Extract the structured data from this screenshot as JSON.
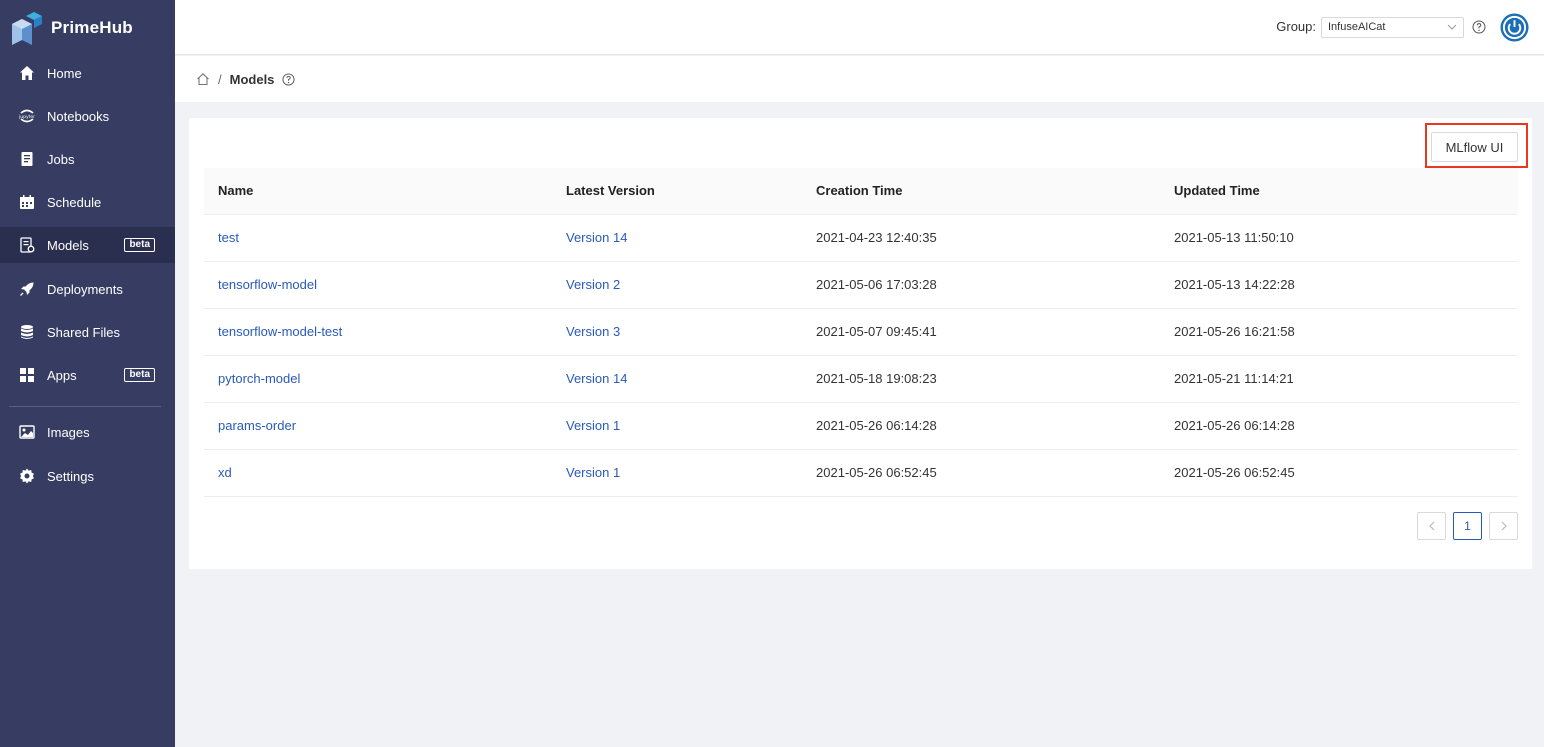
{
  "app": {
    "name": "PrimeHub"
  },
  "sidebar": {
    "items": [
      {
        "label": "Home",
        "icon": "home-icon"
      },
      {
        "label": "Notebooks",
        "icon": "jupyter-icon"
      },
      {
        "label": "Jobs",
        "icon": "jobs-icon"
      },
      {
        "label": "Schedule",
        "icon": "calendar-icon"
      },
      {
        "label": "Models",
        "icon": "models-icon",
        "badge": "beta",
        "active": true
      },
      {
        "label": "Deployments",
        "icon": "rocket-icon"
      },
      {
        "label": "Shared Files",
        "icon": "database-icon"
      },
      {
        "label": "Apps",
        "icon": "apps-icon",
        "badge": "beta"
      },
      {
        "label": "Images",
        "icon": "image-icon"
      },
      {
        "label": "Settings",
        "icon": "gear-icon"
      }
    ]
  },
  "header": {
    "group_label": "Group:",
    "group_value": "InfuseAICat"
  },
  "breadcrumb": {
    "current": "Models"
  },
  "main": {
    "mlflow_button": "MLflow UI",
    "columns": [
      "Name",
      "Latest Version",
      "Creation Time",
      "Updated Time"
    ],
    "rows": [
      {
        "name": "test",
        "version": "Version 14",
        "created": "2021-04-23 12:40:35",
        "updated": "2021-05-13 11:50:10"
      },
      {
        "name": "tensorflow-model",
        "version": "Version 2",
        "created": "2021-05-06 17:03:28",
        "updated": "2021-05-13 14:22:28"
      },
      {
        "name": "tensorflow-model-test",
        "version": "Version 3",
        "created": "2021-05-07 09:45:41",
        "updated": "2021-05-26 16:21:58"
      },
      {
        "name": "pytorch-model",
        "version": "Version 14",
        "created": "2021-05-18 19:08:23",
        "updated": "2021-05-21 11:14:21"
      },
      {
        "name": "params-order",
        "version": "Version 1",
        "created": "2021-05-26 06:14:28",
        "updated": "2021-05-26 06:14:28"
      },
      {
        "name": "xd",
        "version": "Version 1",
        "created": "2021-05-26 06:52:45",
        "updated": "2021-05-26 06:52:45"
      }
    ],
    "pagination": {
      "current_page": "1"
    }
  },
  "colors": {
    "sidebar_bg": "#373d62",
    "sidebar_active": "#2a2f4f",
    "link": "#2a5ab8",
    "highlight": "#e8391f"
  }
}
